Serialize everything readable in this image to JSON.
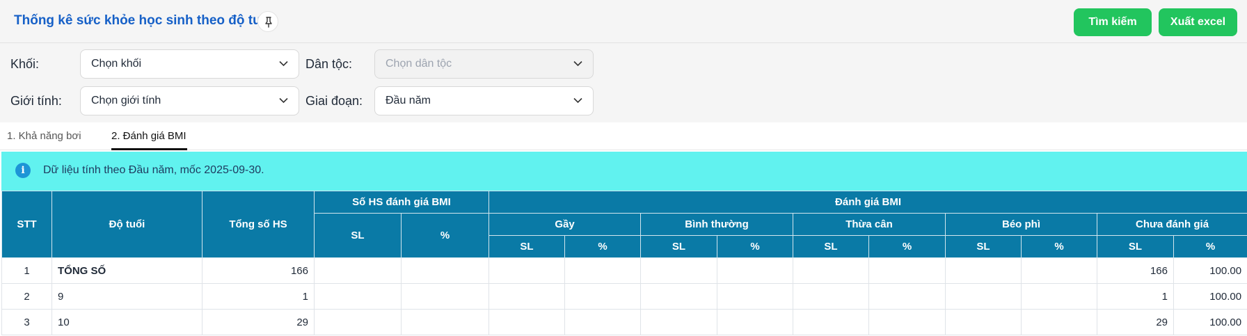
{
  "header": {
    "title": "Thống kê sức khỏe học sinh theo độ tuổi",
    "search_label": "Tìm kiếm",
    "export_label": "Xuất excel"
  },
  "filters": {
    "grade_label": "Khối:",
    "grade_value": "Chọn khối",
    "ethnicity_label": "Dân tộc:",
    "ethnicity_value": "Chọn dân tộc",
    "gender_label": "Giới tính:",
    "gender_value": "Chọn giới tính",
    "period_label": "Giai đoạn:",
    "period_value": "Đầu năm"
  },
  "tabs": [
    {
      "label": "1. Khả năng bơi",
      "active": false
    },
    {
      "label": "2. Đánh giá BMI",
      "active": true
    }
  ],
  "alert": {
    "message": "Dữ liệu tính theo Đầu năm, mốc 2025-09-30."
  },
  "table": {
    "headers": {
      "stt": "STT",
      "age": "Độ tuổi",
      "total": "Tổng số HS",
      "evaluated": "Số HS đánh giá BMI",
      "bmi": "Đánh giá BMI",
      "thin": "Gầy",
      "normal": "Bình thường",
      "overweight": "Thừa cân",
      "obese": "Béo phì",
      "not_evaluated": "Chưa đánh giá",
      "sl": "SL",
      "pct": "%"
    },
    "rows": [
      {
        "stt": "1",
        "age": "TỔNG SỐ",
        "total": "166",
        "na_sl": "166",
        "na_pct": "100.00"
      },
      {
        "stt": "2",
        "age": "9",
        "total": "1",
        "na_sl": "1",
        "na_pct": "100.00"
      },
      {
        "stt": "3",
        "age": "10",
        "total": "29",
        "na_sl": "29",
        "na_pct": "100.00"
      }
    ]
  }
}
